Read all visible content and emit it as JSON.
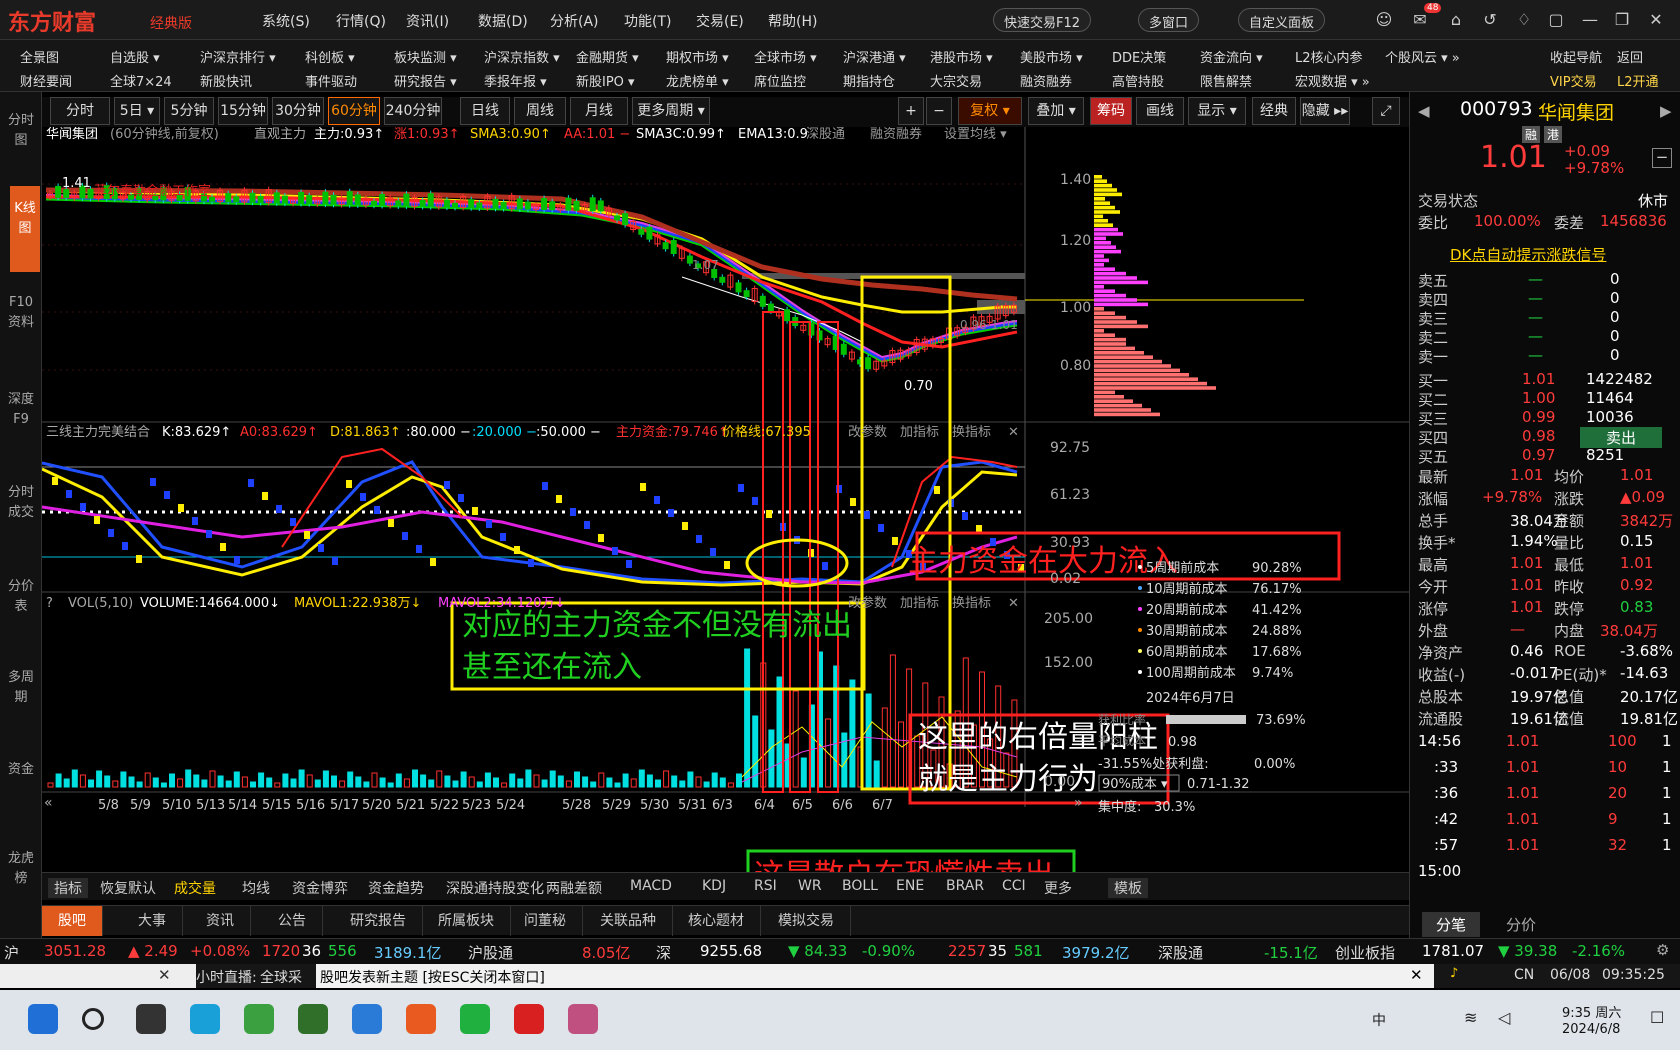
{
  "app": {
    "logo": "东方财富",
    "edition": "经典版",
    "menu": [
      "系统(S)",
      "行情(Q)",
      "资讯(I)",
      "数据(D)",
      "分析(A)",
      "功能(T)",
      "交易(E)",
      "帮助(H)"
    ],
    "quick_trade": "快速交易F12",
    "multi_window": "多窗口",
    "custom_panel": "自定义面板",
    "mail_badge": "48"
  },
  "nav": {
    "row1": [
      "全景图",
      "自选股 ▾",
      "沪深京排行 ▾",
      "科创板 ▾",
      "板块监测 ▾",
      "沪深京指数 ▾",
      "金融期货 ▾",
      "期权市场 ▾",
      "全球市场 ▾",
      "沪深港通 ▾",
      "港股市场 ▾",
      "美股市场 ▾",
      "DDE决策",
      "资金流向 ▾",
      "L2核心内参",
      "个股风云 ▾ »",
      "收起导航",
      "返回"
    ],
    "row2": [
      "财经要闻",
      "全球7×24",
      "新股快讯",
      "事件驱动",
      "研究报告 ▾",
      "季报年报 ▾",
      "新股IPO ▾",
      "龙虎榜单 ▾",
      "席位监控",
      "期指持仓",
      "大宗交易",
      "融资融券",
      "高管持股",
      "限售解禁",
      "宏观数据 ▾ »",
      "VIP交易",
      "L2开通"
    ]
  },
  "leftbar": [
    "分时图",
    "K线图",
    "F10资料",
    "深度F9",
    "分时成交",
    "分价表",
    "多周期",
    "资金",
    "龙虎榜"
  ],
  "periods": [
    "分时",
    "5日 ▾",
    "5分钟",
    "15分钟",
    "30分钟",
    "60分钟",
    "240分钟",
    "日线",
    "周线",
    "月线",
    "更多周期 ▾"
  ],
  "chart_tools": [
    "+",
    "−",
    "复权 ▾",
    "叠加 ▾",
    "筹码",
    "画线",
    "显示 ▾",
    "经典",
    "隐藏 ▸▸"
  ],
  "stock": {
    "code": "000793",
    "name": "华闻集团",
    "price": "1.01",
    "chg": "+0.09",
    "pct": "+9.78%",
    "tag1": "融",
    "tag2": "港"
  },
  "main_chart": {
    "title": "华闻集团",
    "subtitle": "(60分钟线,前复权)",
    "indicator": "直观主力",
    "legend": [
      {
        "t": "主力:0.93↑",
        "c": "#ffffff"
      },
      {
        "t": "涨1:0.93↑",
        "c": "#ff3030"
      },
      {
        "t": "SMA3:0.90↑",
        "c": "#ffd400"
      },
      {
        "t": "AA:1.01 −",
        "c": "#ff3030"
      },
      {
        "t": "SMA3C:0.99↑",
        "c": "#ffffff"
      },
      {
        "t": "EMA13:0.9",
        "c": "#ffffff"
      }
    ],
    "links": [
      "深股通",
      "融资融券",
      "设置均线 ▾"
    ],
    "watermark": "菲尔泰勒金融工作室",
    "high_label": "1.41",
    "low_label": "0.70",
    "mid_label": "1.07",
    "mid2_label": "0.96-1.01",
    "yticks": [
      "1.40",
      "1.20",
      "1.00",
      "0.80"
    ]
  },
  "ind_chart": {
    "title": "三线主力完美结合",
    "legend": [
      {
        "t": "K:83.629↑",
        "c": "#ffffff"
      },
      {
        "t": "A0:83.629↑",
        "c": "#ff3030"
      },
      {
        "t": "D:81.863↑",
        "c": "#ffd400"
      },
      {
        "t": ":80.000 −",
        "c": "#ffffff"
      },
      {
        "t": ":20.000 −",
        "c": "#00e0ff"
      },
      {
        "t": ":50.000 −",
        "c": "#ffffff"
      },
      {
        "t": "主力资金:79.746↑",
        "c": "#ff3030"
      },
      {
        "t": "价格线:67.395",
        "c": "#ffd400"
      }
    ],
    "links": [
      "改参数",
      "加指标",
      "换指标"
    ],
    "yticks": [
      "92.75",
      "61.23",
      "30.93",
      "0.02"
    ]
  },
  "vol_chart": {
    "legend": [
      {
        "t": "VOL(5,10)",
        "c": "#aaaaaa"
      },
      {
        "t": "VOLUME:14664.000↓",
        "c": "#ffffff"
      },
      {
        "t": "MAVOL1:22.938万↓",
        "c": "#ffd400"
      },
      {
        "t": "MAVOL2:34.120万↓",
        "c": "#ff40ff"
      }
    ],
    "links": [
      "改参数",
      "加指标",
      "换指标"
    ],
    "yticks": [
      "205.00",
      "152.00",
      "0.00"
    ],
    "dates": [
      "5/8",
      "5/9",
      "5/10",
      "5/13",
      "5/14",
      "5/15",
      "5/16",
      "5/17",
      "5/20",
      "5/21",
      "5/22",
      "5/23",
      "5/24",
      "5/28",
      "5/29",
      "5/30",
      "5/31",
      "6/3",
      "6/4",
      "6/5",
      "6/6",
      "6/7"
    ]
  },
  "cost": {
    "rows": [
      {
        "t": "5周期前成本",
        "v": "90.28%",
        "c": "#ffffff"
      },
      {
        "t": "10周期前成本",
        "v": "76.17%",
        "c": "#4da6ff"
      },
      {
        "t": "20周期前成本",
        "v": "41.42%",
        "c": "#ff40ff"
      },
      {
        "t": "30周期前成本",
        "v": "24.88%",
        "c": "#ff8a00"
      },
      {
        "t": "60周期前成本",
        "v": "17.68%",
        "c": "#ffff66"
      },
      {
        "t": "100周期前成本",
        "v": "9.74%",
        "c": "#ffffff"
      }
    ],
    "date": "2024年6月7日",
    "profit_label": "获利比率",
    "profit": "73.69%",
    "avg_label": "平均成本",
    "avg": "0.98",
    "bad_label": "-31.55%处获利盘:",
    "bad": "0.00%",
    "range_sel": "90%成本 ▾",
    "range": "0.71-1.32",
    "conc_label": "集中度:",
    "conc": "30.3%"
  },
  "ind_tabs": [
    "指标",
    "恢复默认",
    "成交量",
    "均线",
    "资金博弈",
    "资金趋势",
    "深股通持股变化",
    "两融差额",
    "MACD",
    "KDJ",
    "RSI",
    "WR",
    "BOLL",
    "ENE",
    "BRAR",
    "CCI",
    "更多",
    "模板"
  ],
  "annotations": {
    "a1": "主力资金在大力流入",
    "a2_l1": "对应的主力资金不但没有流出",
    "a2_l2": "甚至还在流入",
    "a3_l1": "这里的右倍量阳柱",
    "a3_l2": "就是主力行为",
    "a4": "这是散户在恐慌性卖出"
  },
  "quote": {
    "status_label": "交易状态",
    "status": "休市",
    "wb_label": "委比",
    "wb": "100.00%",
    "wc_label": "委差",
    "wc": "1456836",
    "signal": "DK点自动提示涨跌信号",
    "asks": [
      {
        "l": "卖五",
        "p": "—",
        "v": "0"
      },
      {
        "l": "卖四",
        "p": "—",
        "v": "0"
      },
      {
        "l": "卖三",
        "p": "—",
        "v": "0"
      },
      {
        "l": "卖二",
        "p": "—",
        "v": "0"
      },
      {
        "l": "卖一",
        "p": "—",
        "v": "0"
      }
    ],
    "bids": [
      {
        "l": "买一",
        "p": "1.01",
        "v": "1422482"
      },
      {
        "l": "买二",
        "p": "1.00",
        "v": "11464"
      },
      {
        "l": "买三",
        "p": "0.99",
        "v": "10036"
      },
      {
        "l": "买四",
        "p": "0.98",
        "v": "卖出"
      },
      {
        "l": "买五",
        "p": "0.97",
        "v": "8251"
      }
    ],
    "stats": [
      [
        "最新",
        "1.01",
        "均价",
        "1.01"
      ],
      [
        "涨幅",
        "+9.78%",
        "涨跌",
        "▲0.09"
      ],
      [
        "总手",
        "38.04万",
        "金额",
        "3842万"
      ],
      [
        "换手*",
        "1.94%",
        "量比",
        "0.15"
      ],
      [
        "最高",
        "1.01",
        "最低",
        "1.01"
      ],
      [
        "今开",
        "1.01",
        "昨收",
        "0.92"
      ],
      [
        "涨停",
        "1.01",
        "跌停",
        "0.83"
      ],
      [
        "外盘",
        "—",
        "内盘",
        "38.04万"
      ],
      [
        "净资产",
        "0.46",
        "ROE",
        "-3.68%"
      ],
      [
        "收益(-)",
        "-0.017",
        "PE(动)*",
        "-14.63"
      ],
      [
        "总股本",
        "19.97亿",
        "总值",
        "20.17亿"
      ],
      [
        "流通股",
        "19.61亿",
        "流值",
        "19.81亿"
      ]
    ],
    "ticks": [
      {
        "t": "14:56",
        "p": "1.01",
        "v": "100",
        "n": "1"
      },
      {
        "t": ":33",
        "p": "1.01",
        "v": "10",
        "n": "1"
      },
      {
        "t": ":36",
        "p": "1.01",
        "v": "20",
        "n": "1"
      },
      {
        "t": ":42",
        "p": "1.01",
        "v": "9",
        "n": "1"
      },
      {
        "t": ":57",
        "p": "1.01",
        "v": "32",
        "n": "1"
      },
      {
        "t": "15:00",
        "p": "",
        "v": "",
        "n": ""
      }
    ],
    "tab1": "分笔",
    "tab2": "分价"
  },
  "bottom_tabs": [
    "股吧",
    "大事",
    "资讯",
    "公告",
    "研究报告",
    "所属板块",
    "问董秘",
    "关联品种",
    "核心题材",
    "模拟交易"
  ],
  "index": {
    "sh": "沪",
    "sh_v": "3051.28",
    "sh_c": "▲ 2.49",
    "sh_p": "+0.08%",
    "sh_u": "1720",
    "sh_f": "36",
    "sh_d": "556",
    "sh_a": "3189.1亿",
    "hgt": "沪股通",
    "hgt_v": "8.05亿",
    "sz": "深",
    "sz_v": "9255.68",
    "sz_c": "▼ 84.33",
    "sz_p": "-0.90%",
    "sz_u": "2257",
    "sz_f": "35",
    "sz_d": "581",
    "sz_a": "3979.2亿",
    "sgt": "深股通",
    "sgt_v": "-15.1亿",
    "cyb": "创业板指",
    "cyb_v": "1781.07",
    "cyb_c": "▼ 39.38",
    "cyb_p": "-2.16%"
  },
  "notebar": {
    "live": "小时直播:",
    "live_text": "全球采",
    "tip": "股吧发表新主题 [按ESC关闭本窗口]",
    "cn": "CN",
    "date": "06/08",
    "time": "09:35:25"
  },
  "taskbar": {
    "time": "9:35 周六",
    "date": "2024/6/8",
    "ime": "中"
  }
}
